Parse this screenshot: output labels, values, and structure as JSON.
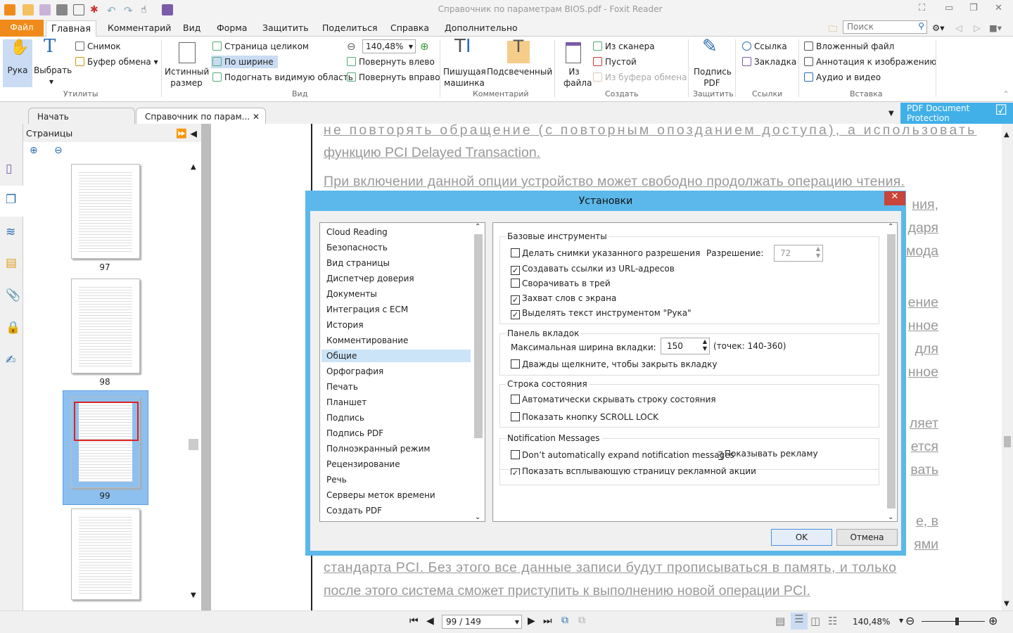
{
  "app": {
    "title": "Справочник по параметрам BIOS.pdf - Foxit Reader"
  },
  "menu": {
    "file": "Файл",
    "tabs": [
      "Главная",
      "Комментарий",
      "Вид",
      "Форма",
      "Защитить",
      "Поделиться",
      "Справка",
      "Дополнительно"
    ],
    "search_placeholder": "Поиск"
  },
  "ribbon": {
    "hand": "Рука",
    "select": "Выбрать",
    "snapshot": "Снимок",
    "clipboard": "Буфер обмена",
    "group_utils": "Утилиты",
    "actual_size": "Истинный размер",
    "full_page": "Страница целиком",
    "fit_width": "По ширине",
    "fit_visible": "Подогнать видимую область",
    "zoom": "140,48%",
    "rotate_left": "Повернуть влево",
    "rotate_right": "Повернуть вправо",
    "group_view": "Вид",
    "typewriter": "Пишущая машинка",
    "highlight": "Подсвеченный",
    "group_comment": "Комментарий",
    "from_file": "Из файла",
    "from_scanner": "Из сканера",
    "blank": "Пустой",
    "from_clipboard": "Из буфера обмена",
    "group_create": "Создать",
    "sign_pdf": "Подпись PDF",
    "group_protect": "Защитить",
    "link": "Ссылка",
    "bookmark": "Закладка",
    "group_links": "Ссылки",
    "attachment": "Вложенный файл",
    "image_annotation": "Аннотация к изображению",
    "audio_video": "Аудио и видео",
    "group_insert": "Вставка"
  },
  "doc_tabs": [
    {
      "label": "Начать"
    },
    {
      "label": "Справочник по парам..."
    }
  ],
  "promo": "PDF Document Protection",
  "pages_panel": {
    "title": "Страницы",
    "thumbnails": [
      "97",
      "98",
      "99"
    ],
    "current": "99"
  },
  "document": {
    "lines": [
      "не повторять обращение (с повторным опозданием доступа), а использовать",
      "функцию PCI Delayed Transaction.",
      "При включении данной опции устройство может свободно продолжать операцию чтения.",
      "ния,",
      "даря",
      "мода",
      "ение",
      "нное",
      "для",
      "нное",
      "ляет",
      "ется",
      "вать",
      "е, в",
      "ями",
      "стандарта PCI. Без этого все данные записи будут прописываться в память, и только",
      "после этого система сможет приступить к выполнению новой операции PCI."
    ]
  },
  "dialog": {
    "title": "Установки",
    "categories": [
      "Cloud Reading",
      "Безопасность",
      "Вид страницы",
      "Диспетчер доверия",
      "Документы",
      "Интеграция с ECM",
      "История",
      "Комментирование",
      "Общие",
      "Орфография",
      "Печать",
      "Планшет",
      "Подпись",
      "Подпись PDF",
      "Полноэкранный режим",
      "Рецензирование",
      "Речь",
      "Серверы меток времени",
      "Создать PDF"
    ],
    "selected": "Общие",
    "basic": {
      "title": "Базовые инструменты",
      "snapshot_res": "Делать снимки указанного разрешения",
      "resolution_label": "Разрешение:",
      "resolution": "72",
      "url_links": "Создавать ссылки из URL-адресов",
      "minimize_tray": "Сворачивать в трей",
      "word_capture": "Захват слов с экрана",
      "hand_select": "Выделять текст инструментом \"Рука\""
    },
    "tabs": {
      "title": "Панель вкладок",
      "max_width_label": "Максимальная ширина вкладки:",
      "max_width": "150",
      "range": "(точек: 140-360)",
      "dblclick_close": "Дважды щелкните, чтобы закрыть вкладку"
    },
    "statusbar": {
      "title": "Строка состояния",
      "auto_hide": "Автоматически скрывать строку состояния",
      "scroll_lock": "Показать кнопку SCROLL LOCK"
    },
    "notif": {
      "title": "Notification Messages",
      "no_expand": "Don’t automatically expand notification messages",
      "show_ads": "Показывать рекламу",
      "promo_page": "Показать всплывающую страницу рекламной акции"
    },
    "checks": {
      "snapshot_res": false,
      "url_links": true,
      "minimize_tray": false,
      "word_capture": true,
      "hand_select": true,
      "dblclick_close": false,
      "auto_hide": false,
      "scroll_lock": false,
      "no_expand": false,
      "promo_page": true
    },
    "ok": "OK",
    "cancel": "Отмена"
  },
  "statusbar": {
    "page": "99 / 149",
    "zoom": "140,48%",
    "zoom_slider_fraction": 0.55
  },
  "colors": {
    "file_tab": "#f08a1a",
    "dialog_border": "#5cb8ea",
    "selection": "#cce4f7",
    "promo": "#41b0e8"
  }
}
